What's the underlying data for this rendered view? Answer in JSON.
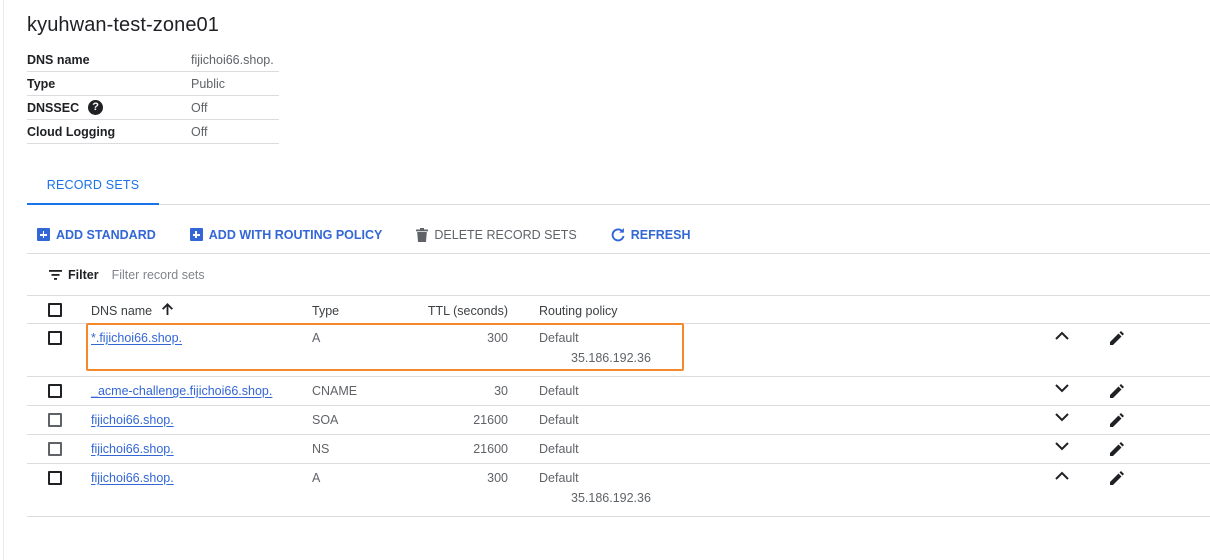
{
  "zone": {
    "title": "kyuhwan-test-zone01",
    "details": [
      {
        "key": "DNS name",
        "value": "fijichoi66.shop."
      },
      {
        "key": "Type",
        "value": "Public"
      },
      {
        "key": "DNSSEC",
        "value": "Off",
        "help_icon": "help-circle-icon"
      },
      {
        "key": "Cloud Logging",
        "value": "Off"
      }
    ]
  },
  "tabs": [
    {
      "label": "RECORD SETS",
      "active": true
    }
  ],
  "toolbar": {
    "add_standard": "ADD STANDARD",
    "add_routing": "ADD WITH ROUTING POLICY",
    "delete": "DELETE RECORD SETS",
    "refresh": "REFRESH"
  },
  "filter": {
    "label": "Filter",
    "placeholder": "Filter record sets"
  },
  "table": {
    "headers": {
      "name": "DNS name",
      "type": "Type",
      "ttl": "TTL (seconds)",
      "policy": "Routing policy"
    },
    "rows": [
      {
        "name": "*.fijichoi66.shop.",
        "type": "A",
        "ttl": "300",
        "policy": "Default",
        "data": "35.186.192.36",
        "expanded": true,
        "highlighted": true
      },
      {
        "name": "_acme-challenge.fijichoi66.shop.",
        "type": "CNAME",
        "ttl": "30",
        "policy": "Default",
        "expanded": false
      },
      {
        "name": "fijichoi66.shop.",
        "type": "SOA",
        "ttl": "21600",
        "policy": "Default",
        "expanded": false
      },
      {
        "name": "fijichoi66.shop.",
        "type": "NS",
        "ttl": "21600",
        "policy": "Default",
        "expanded": false
      },
      {
        "name": "fijichoi66.shop.",
        "type": "A",
        "ttl": "300",
        "policy": "Default",
        "data": "35.186.192.36",
        "expanded": true
      }
    ]
  },
  "colors": {
    "accent": "#1a73e8",
    "link": "#3367d6",
    "highlight_border": "#f4882b"
  }
}
